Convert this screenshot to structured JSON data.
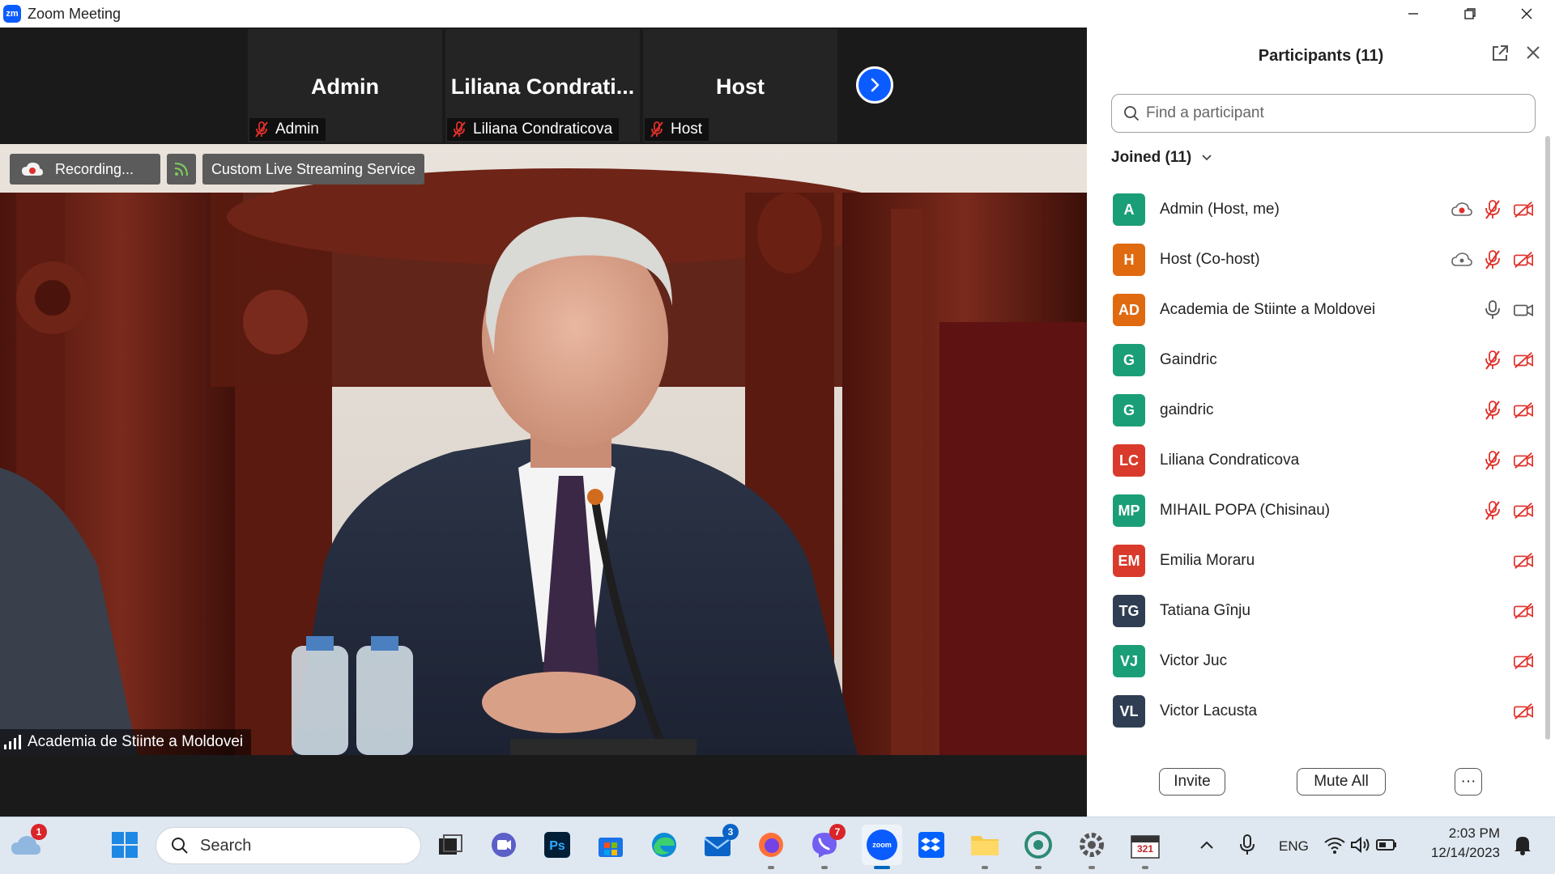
{
  "window": {
    "app_logo": "zm",
    "title": "Zoom Meeting"
  },
  "thumbnails": [
    {
      "display_name": "Admin",
      "tag_name": "Admin"
    },
    {
      "display_name": "Liliana  Condrati...",
      "tag_name": "Liliana Condraticova"
    },
    {
      "display_name": "Host",
      "tag_name": "Host"
    }
  ],
  "main_video": {
    "recording_label": "Recording...",
    "streaming_label": "Custom Live Streaming Service",
    "speaker_label": "Academia de Stiinte a Moldovei"
  },
  "panel": {
    "title": "Participants (11)",
    "search_placeholder": "Find a participant",
    "joined_label": "Joined (11)",
    "participants": [
      {
        "initials": "A",
        "name": "Admin (Host, me)",
        "color": "#1a9e77",
        "icons": [
          "cloud-record-icon",
          "mic-muted-icon",
          "video-off-icon"
        ]
      },
      {
        "initials": "H",
        "name": "Host (Co-host)",
        "color": "#e06a10",
        "icons": [
          "cloud-icon",
          "mic-muted-icon",
          "video-off-icon"
        ]
      },
      {
        "initials": "AD",
        "name": "Academia de Stiinte a Moldovei",
        "color": "#e06a10",
        "icons": [
          "mic-icon",
          "video-icon"
        ]
      },
      {
        "initials": "G",
        "name": "Gaindric",
        "color": "#1a9e77",
        "icons": [
          "mic-muted-icon",
          "video-off-icon"
        ]
      },
      {
        "initials": "G",
        "name": "gaindric",
        "color": "#1a9e77",
        "icons": [
          "mic-muted-icon",
          "video-off-icon"
        ]
      },
      {
        "initials": "LC",
        "name": "Liliana Condraticova",
        "color": "#d93a2b",
        "icons": [
          "mic-muted-icon",
          "video-off-icon"
        ]
      },
      {
        "initials": "MP",
        "name": "MIHAIL POPA (Chisinau)",
        "color": "#1a9e77",
        "icons": [
          "mic-muted-icon",
          "video-off-icon"
        ]
      },
      {
        "initials": "EM",
        "name": "Emilia Moraru",
        "color": "#d93a2b",
        "icons": [
          "video-off-icon"
        ]
      },
      {
        "initials": "TG",
        "name": "Tatiana Gînju",
        "color": "#2f3e52",
        "icons": [
          "video-off-icon"
        ]
      },
      {
        "initials": "VJ",
        "name": "Victor Juc",
        "color": "#1a9e77",
        "icons": [
          "video-off-icon"
        ]
      },
      {
        "initials": "VL",
        "name": "Victor Lacusta",
        "color": "#2f3e52",
        "icons": [
          "video-off-icon"
        ]
      }
    ],
    "invite_label": "Invite",
    "mute_all_label": "Mute All",
    "more_label": "···"
  },
  "taskbar": {
    "weather_badge": "1",
    "search_placeholder": "Search",
    "mail_badge": "3",
    "viber_badge": "7",
    "zoom_label": "zoom",
    "calendar_label": "321",
    "language": "ENG",
    "time": "2:03 PM",
    "date": "12/14/2023"
  },
  "colors": {
    "zoom_blue": "#0b5cff",
    "muted_red": "#e0302a",
    "panel_bg": "#ffffff",
    "video_bg": "#1a1a1a"
  }
}
